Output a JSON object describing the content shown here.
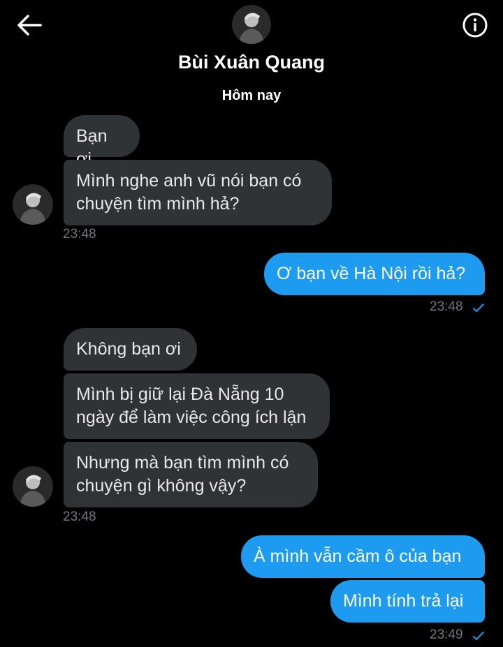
{
  "header": {
    "contact_name": "Bùi Xuân Quang",
    "back_icon": "arrow-left-icon",
    "info_icon": "info-icon"
  },
  "date_separator": "Hôm nay",
  "messages": [
    {
      "text": "Bạn ơi",
      "side": "incoming"
    },
    {
      "text": "Mình nghe anh vũ nói bạn có\nchuyện tìm mình hả?",
      "side": "incoming"
    },
    {
      "text": "Ơ bạn về Hà Nội rồi hả?",
      "side": "outgoing"
    },
    {
      "text": "Không bạn ơi",
      "side": "incoming"
    },
    {
      "text": "Mình bị giữ lại Đà Nẵng 10\nngày để làm việc công ích lận",
      "side": "incoming"
    },
    {
      "text": "Nhưng mà bạn tìm mình có\nchuyện gì không vậy?",
      "side": "incoming"
    },
    {
      "text": "À mình vẫn cầm ô của bạn",
      "side": "outgoing"
    },
    {
      "text": "Mình tính trả lại",
      "side": "outgoing"
    }
  ],
  "timestamps": {
    "group1": "23:48",
    "group2": "23:48",
    "group3": "23:48",
    "group4": "23:49"
  },
  "colors": {
    "background": "#000000",
    "incoming_bubble": "#2f3336",
    "outgoing_bubble": "#1d9bf0",
    "timestamp": "#71767b"
  }
}
